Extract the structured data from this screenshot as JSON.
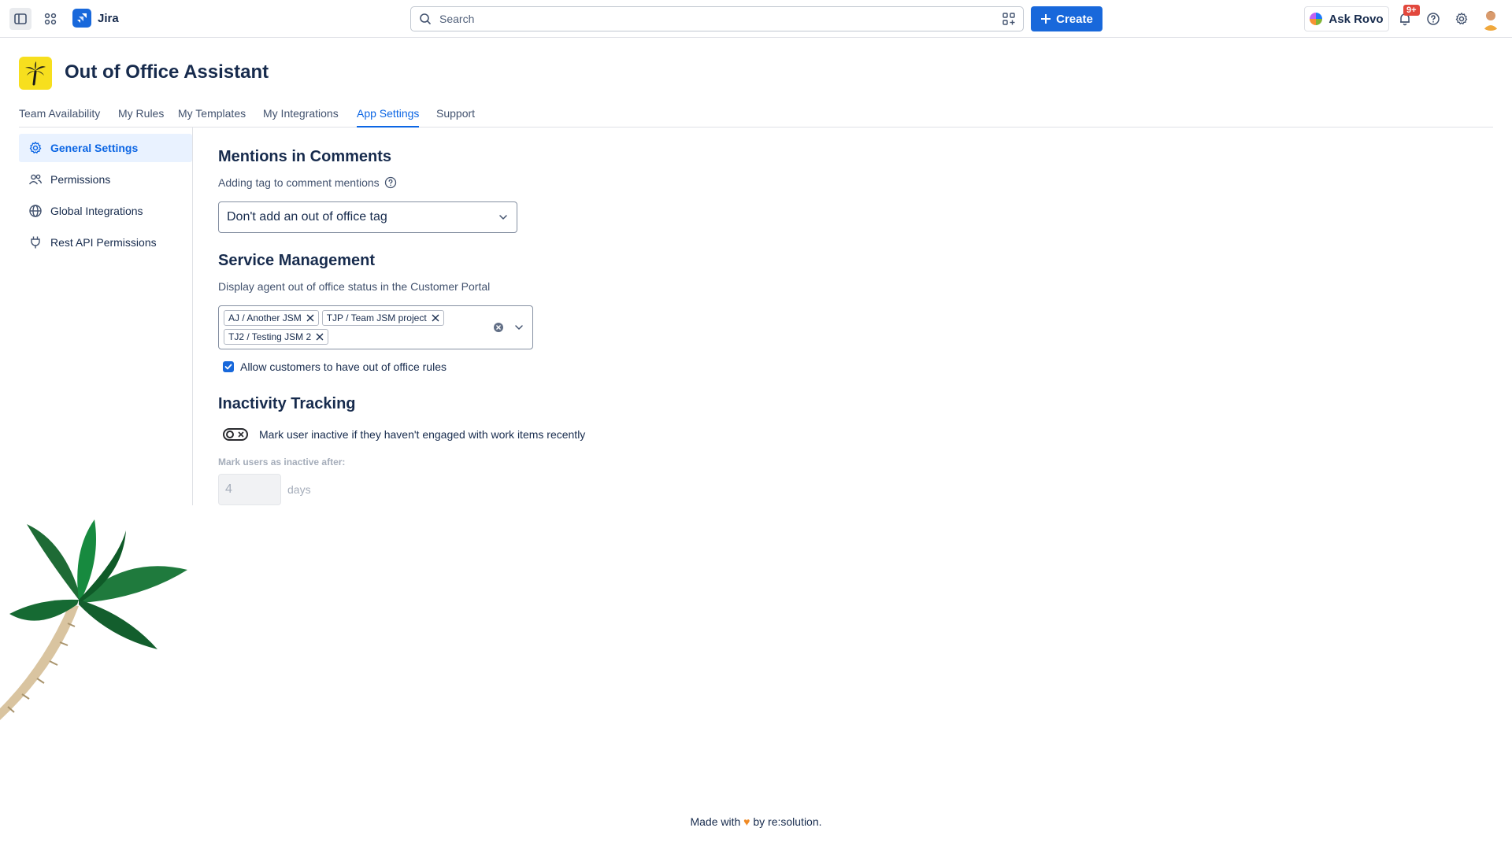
{
  "topbar": {
    "app_name": "Jira",
    "search_placeholder": "Search",
    "create_label": "Create",
    "ask_rovo_label": "Ask Rovo",
    "notifications_badge": "9+"
  },
  "header": {
    "title": "Out of Office Assistant"
  },
  "tabs": [
    {
      "label": "Team Availability"
    },
    {
      "label": "My Rules"
    },
    {
      "label": "My Templates"
    },
    {
      "label": "My Integrations"
    },
    {
      "label": "App Settings",
      "active": true
    },
    {
      "label": "Support"
    }
  ],
  "sidebar": {
    "items": [
      {
        "label": "General Settings",
        "icon": "gear-icon",
        "active": true
      },
      {
        "label": "Permissions",
        "icon": "people-icon"
      },
      {
        "label": "Global Integrations",
        "icon": "globe-icon"
      },
      {
        "label": "Rest API Permissions",
        "icon": "plug-icon"
      }
    ]
  },
  "mentions": {
    "title": "Mentions in Comments",
    "description": "Adding tag to comment mentions",
    "select_value": "Don't add an out of office tag"
  },
  "service": {
    "title": "Service Management",
    "description": "Display agent out of office status in the Customer Portal",
    "tags": [
      "AJ / Another JSM",
      "TJP / Team JSM project",
      "TJ2 / Testing JSM 2"
    ],
    "checkbox_label": "Allow customers to have out of office rules",
    "checkbox_checked": true
  },
  "inactivity": {
    "title": "Inactivity Tracking",
    "toggle_label": "Mark user inactive if they haven't engaged with work items recently",
    "toggle_on": false,
    "field_label": "Mark users as inactive after:",
    "field_value": "4",
    "unit": "days"
  },
  "footer": {
    "prefix": "Made with",
    "suffix": "by re:solution."
  },
  "colors": {
    "accent": "#1868db",
    "active_tab": "#0c66e4",
    "app_icon_bg": "#f7df1e",
    "badge": "#e2483d"
  }
}
